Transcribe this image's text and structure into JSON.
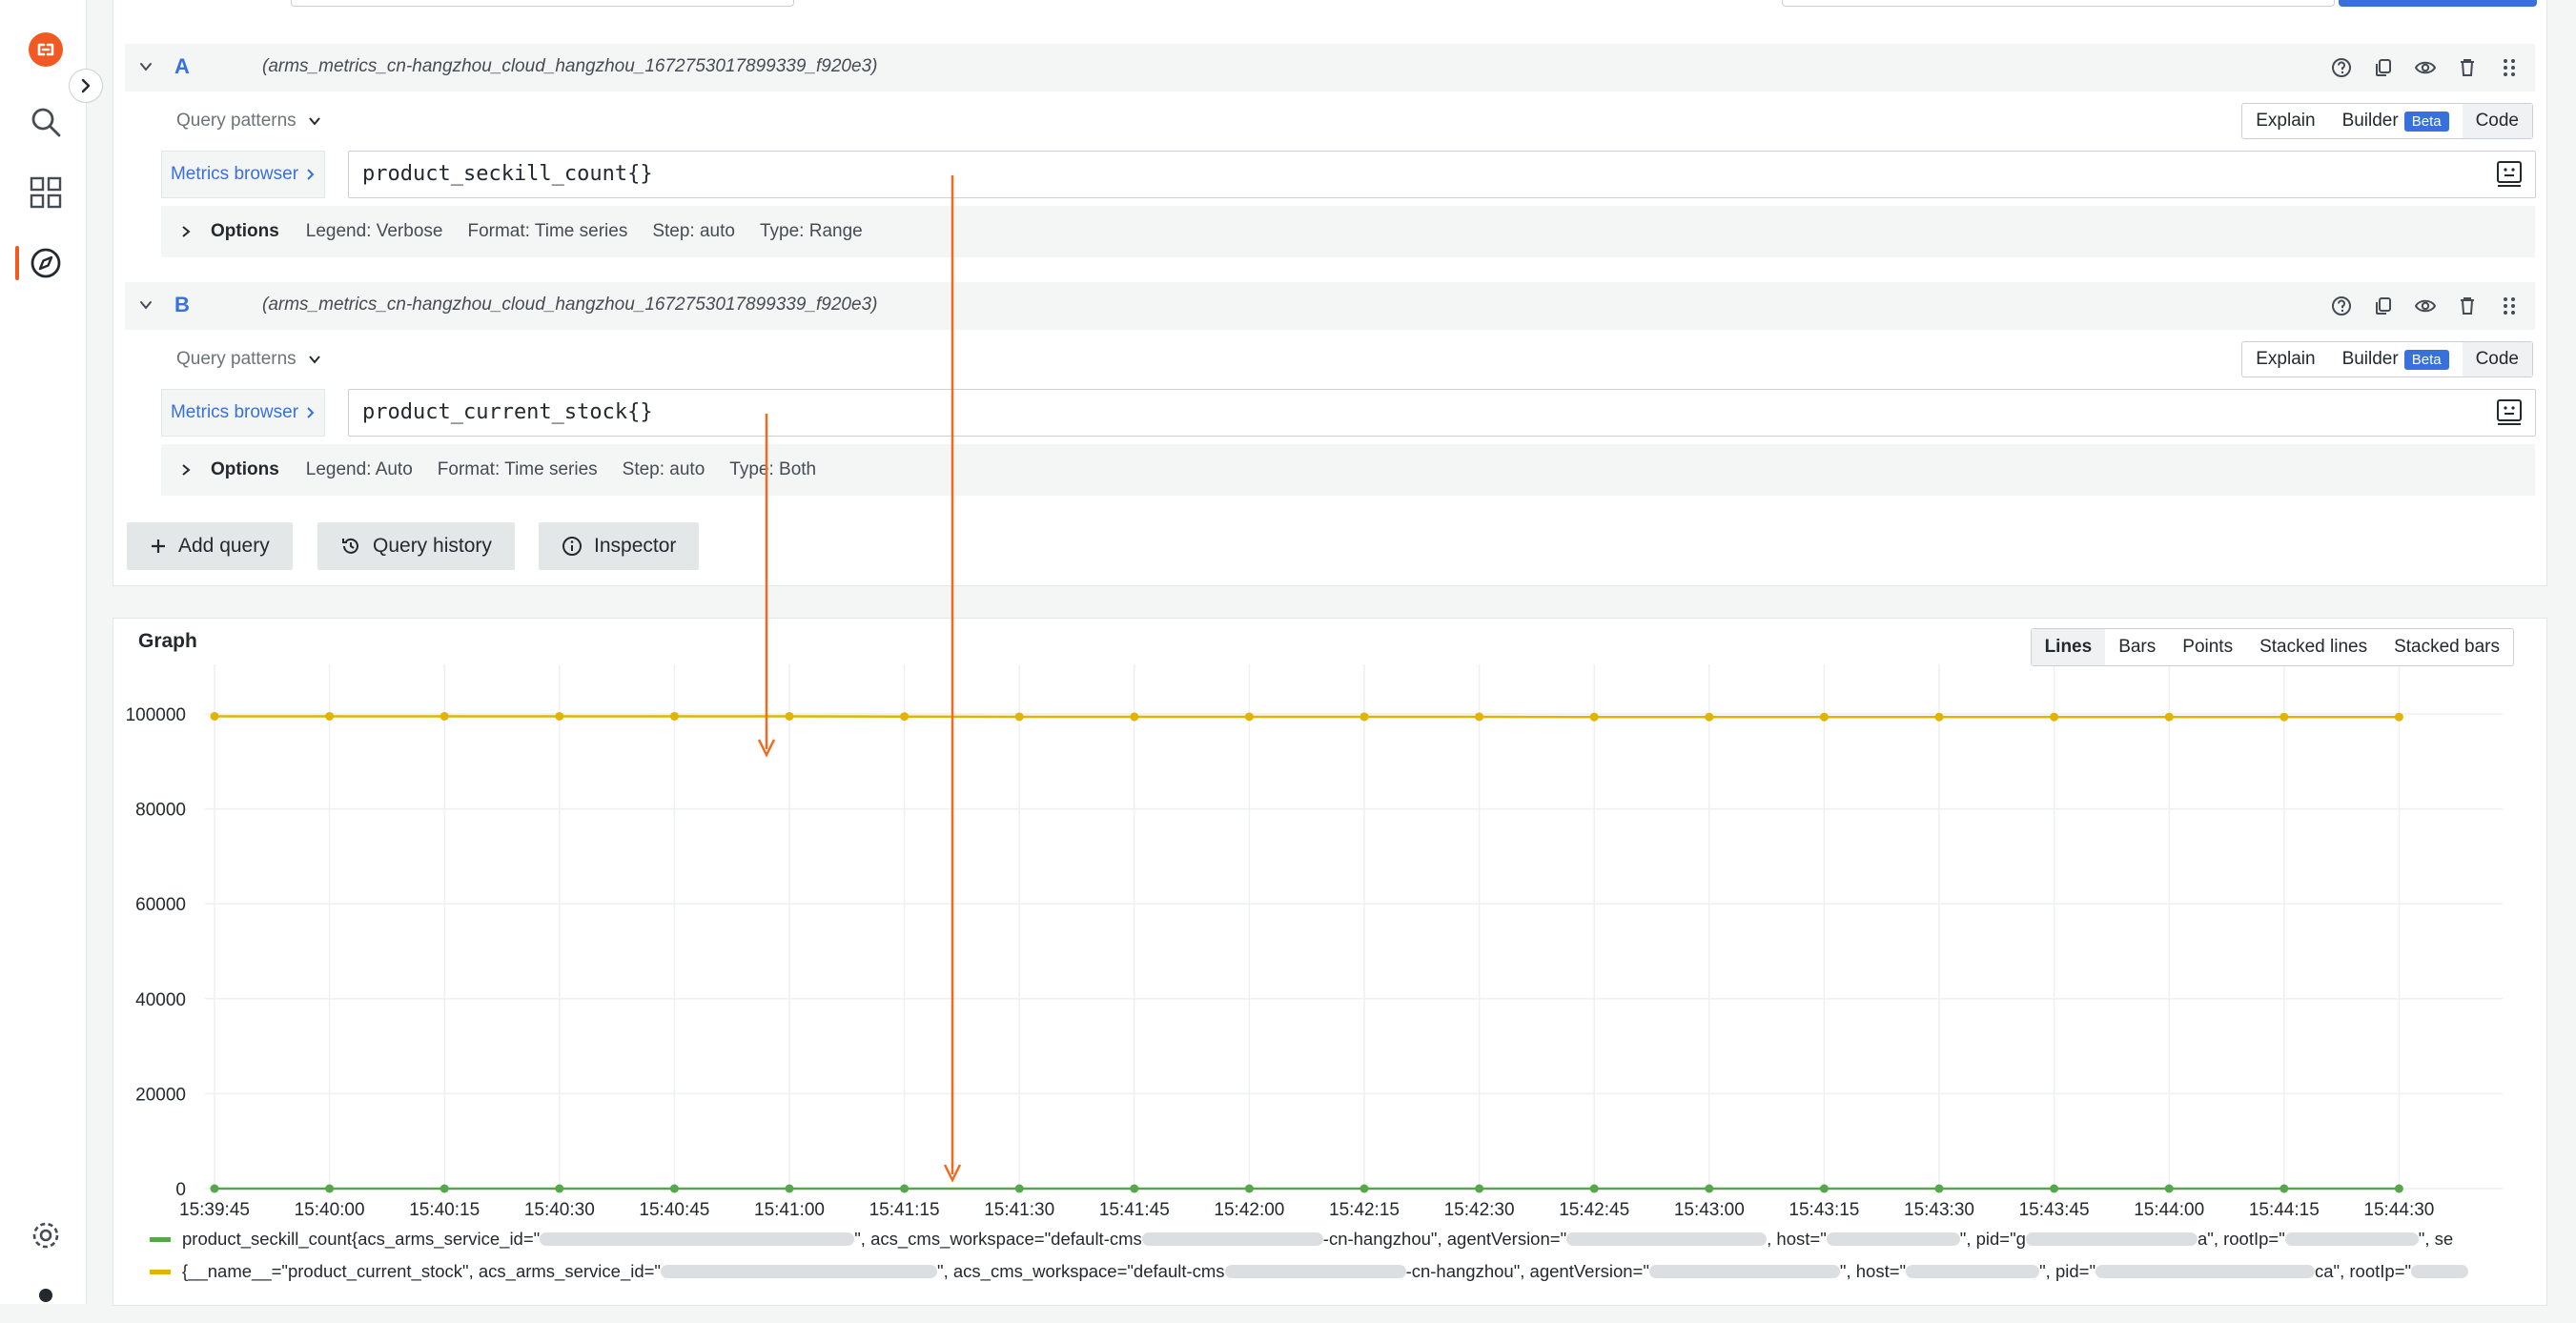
{
  "colors": {
    "accent": "#3871dc",
    "series_seckill": "#56a64b",
    "series_stock": "#e0b400",
    "annotation": "#ed6c1f",
    "logo": "#f05a22"
  },
  "sidebar": {
    "icons": [
      "logo-icon",
      "search-icon",
      "dashboards-icon",
      "explore-icon",
      "settings-icon",
      "profile-icon"
    ]
  },
  "queries": [
    {
      "letter": "A",
      "datasource": "(arms_metrics_cn-hangzhou_cloud_hangzhou_1672753017899339_f920e3)",
      "patterns_label": "Query patterns",
      "modes": [
        "Explain",
        "Builder",
        "Code"
      ],
      "beta_label": "Beta",
      "metrics_browser_label": "Metrics browser",
      "code": "product_seckill_count{}",
      "options_label": "Options",
      "options": [
        "Legend: Verbose",
        "Format: Time series",
        "Step: auto",
        "Type: Range"
      ]
    },
    {
      "letter": "B",
      "datasource": "(arms_metrics_cn-hangzhou_cloud_hangzhou_1672753017899339_f920e3)",
      "patterns_label": "Query patterns",
      "modes": [
        "Explain",
        "Builder",
        "Code"
      ],
      "beta_label": "Beta",
      "metrics_browser_label": "Metrics browser",
      "code": "product_current_stock{}",
      "options_label": "Options",
      "options": [
        "Legend: Auto",
        "Format: Time series",
        "Step: auto",
        "Type: Both"
      ]
    }
  ],
  "actions": {
    "add_query": "Add query",
    "query_history": "Query history",
    "inspector": "Inspector"
  },
  "graph": {
    "title": "Graph",
    "modes": [
      "Lines",
      "Bars",
      "Points",
      "Stacked lines",
      "Stacked bars"
    ],
    "active_mode": "Lines"
  },
  "chart_data": {
    "type": "line",
    "x": [
      "15:39:45",
      "15:40:00",
      "15:40:15",
      "15:40:30",
      "15:40:45",
      "15:41:00",
      "15:41:15",
      "15:41:30",
      "15:41:45",
      "15:42:00",
      "15:42:15",
      "15:42:30",
      "15:42:45",
      "15:43:00",
      "15:43:15",
      "15:43:30",
      "15:43:45",
      "15:44:00",
      "15:44:15",
      "15:44:30"
    ],
    "y_ticks": [
      0,
      20000,
      40000,
      60000,
      80000,
      100000
    ],
    "ylim": [
      0,
      100000
    ],
    "grid": true,
    "legend_position": "bottom",
    "series": [
      {
        "color": "#56a64b",
        "values": [
          0,
          0,
          0,
          0,
          0,
          0,
          0,
          0,
          0,
          0,
          0,
          0,
          0,
          0,
          0,
          0,
          0,
          0,
          0,
          0
        ]
      },
      {
        "color": "#e0b400",
        "values": [
          99500,
          99500,
          99500,
          99500,
          99500,
          99500,
          99450,
          99400,
          99400,
          99400,
          99400,
          99400,
          99350,
          99350,
          99350,
          99350,
          99350,
          99350,
          99350,
          99350
        ]
      }
    ]
  },
  "legend": {
    "seckill": {
      "p1": "product_seckill_count{acs_arms_service_id=\"",
      "p2": "\", acs_cms_workspace=\"default-cms",
      "p3": "-cn-hangzhou\", agentVersion=\"",
      "p4": ", host=\"",
      "p5": "\", pid=\"g",
      "p6": "a\", rootIp=\"",
      "p7": "\", se"
    },
    "stock": {
      "p1": "{__name__=\"product_current_stock\", acs_arms_service_id=\"",
      "p2": "\", acs_cms_workspace=\"default-cms",
      "p3": "-cn-hangzhou\", agentVersion=\"",
      "p4": "\", host=\"",
      "p5": "\", pid=\"",
      "p6": "ca\", rootIp=\""
    }
  }
}
